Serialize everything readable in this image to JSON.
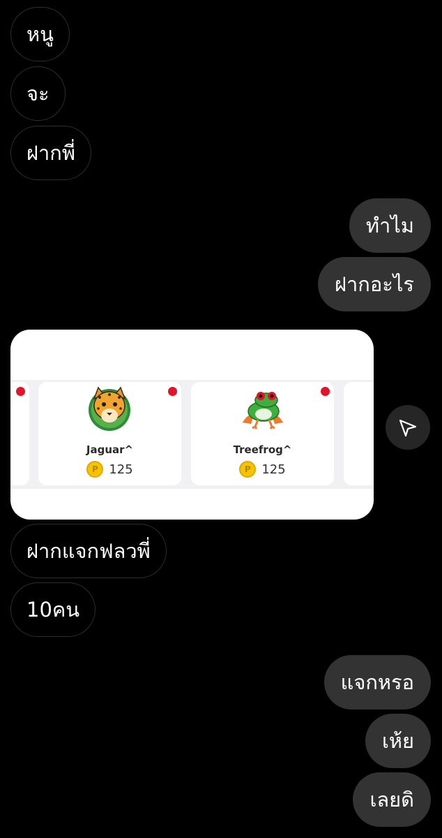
{
  "messages_top": {
    "m1": "หนู",
    "m2": "จะ",
    "m3": "ฝากพี่",
    "m4": "ทำไม",
    "m5": "ฝากอะไร"
  },
  "shared_post": {
    "items": [
      {
        "name": "Jaguar^",
        "price": "125",
        "coin_symbol": "P"
      },
      {
        "name": "Treefrog^",
        "price": "125",
        "coin_symbol": "P"
      }
    ],
    "accent_color": "#e0142b"
  },
  "messages_bottom": {
    "m6": "ฝากแจกฟลวพี่",
    "m7": "10คน",
    "m8": "แจกหรอ",
    "m9": "เห้ย",
    "m10": "เลยดิ"
  },
  "icons": {
    "share": "send-icon"
  }
}
